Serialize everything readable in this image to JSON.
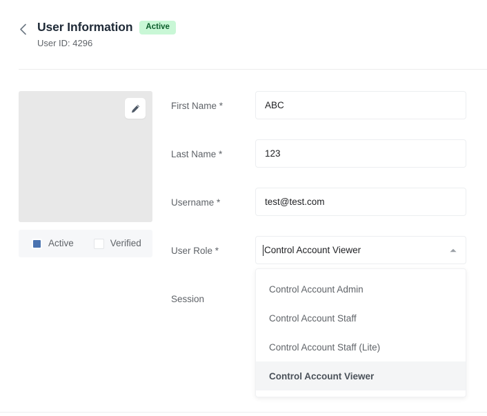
{
  "header": {
    "back_icon": "chevron-left-icon",
    "title": "User Information",
    "status_badge": "Active",
    "user_id": "User ID: 4296"
  },
  "avatar": {
    "edit_icon": "pencil-icon",
    "toggles": [
      {
        "label": "Active",
        "checked": true
      },
      {
        "label": "Verified",
        "checked": false
      }
    ]
  },
  "form": {
    "fields": [
      {
        "label": "First Name *",
        "value": "ABC"
      },
      {
        "label": "Last Name *",
        "value": "123"
      },
      {
        "label": "Username *",
        "value": "test@test.com"
      }
    ],
    "user_role": {
      "label": "User Role *",
      "value": "Control Account Viewer",
      "arrow_icon": "triangle-up-icon",
      "expanded": true,
      "options": [
        "Control Account Admin",
        "Control Account Staff",
        "Control Account Staff (Lite)",
        "Control Account Viewer"
      ],
      "selected_option": "Control Account Viewer"
    },
    "session": {
      "label": "Session"
    }
  },
  "colors": {
    "badge_bg": "#c9f7d6",
    "badge_text": "#0b5c2a",
    "checkbox_checked": "#4a73b0",
    "option_highlight": "#f4f5f6"
  }
}
